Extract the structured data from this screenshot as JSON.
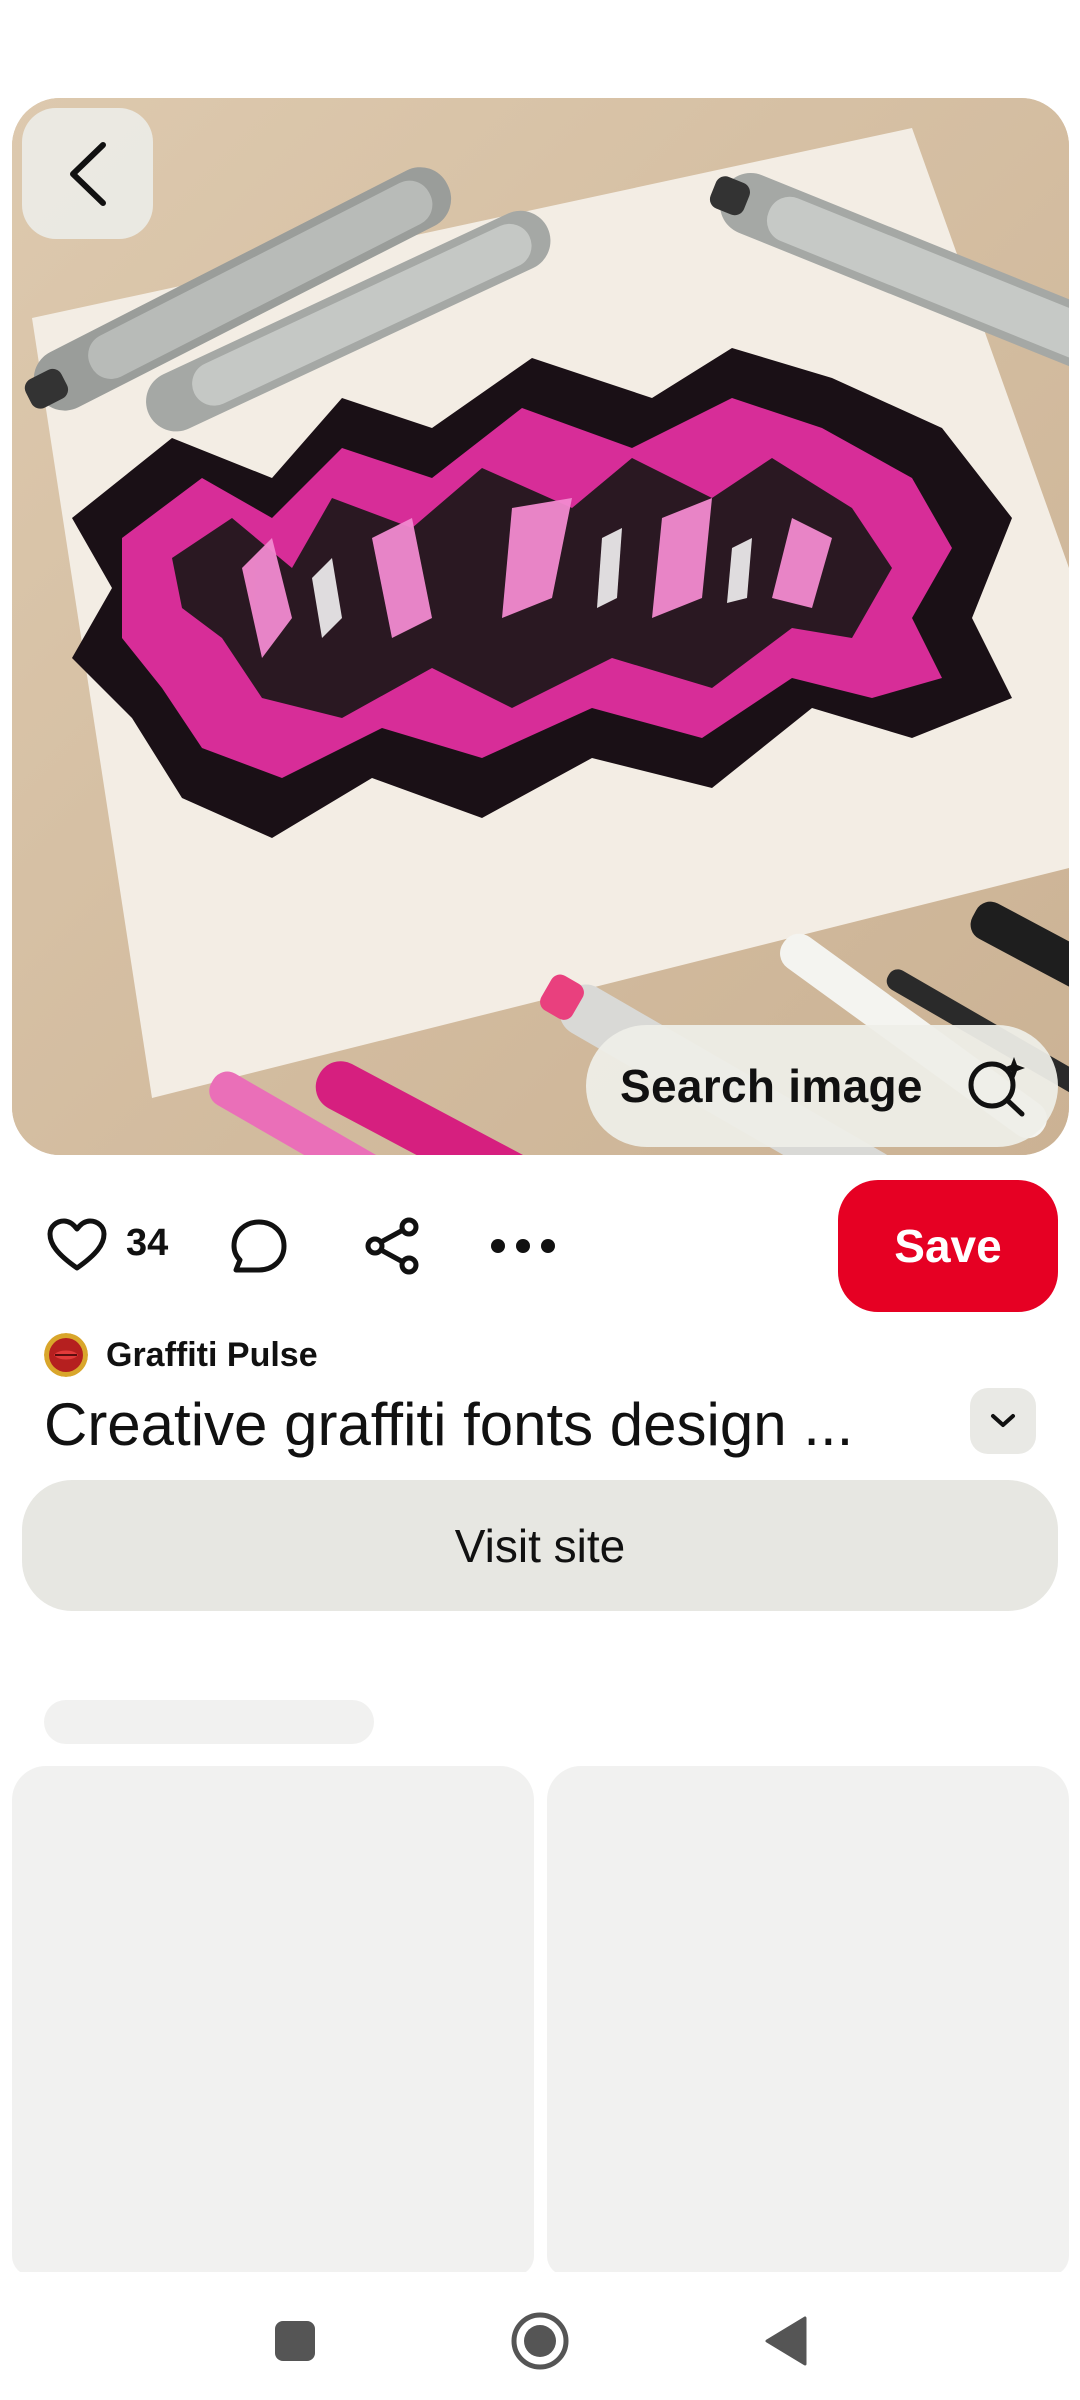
{
  "hero": {
    "back_icon": "chevron-left-icon",
    "search_image_label": "Search image",
    "search_image_icon": "visual-search-icon"
  },
  "actions": {
    "like_icon": "heart-icon",
    "like_count": "34",
    "comment_icon": "comment-icon",
    "share_icon": "share-icon",
    "more_icon": "more-horizontal-icon",
    "save_label": "Save",
    "save_color": "#e60023"
  },
  "pin": {
    "creator_name": "Graffiti Pulse",
    "title": "Creative graffiti fonts design ...",
    "expand_icon": "chevron-down-icon",
    "visit_label": "Visit site"
  },
  "system_nav": {
    "recents_icon": "square-icon",
    "home_icon": "circle-home-icon",
    "back_icon": "triangle-back-icon"
  }
}
